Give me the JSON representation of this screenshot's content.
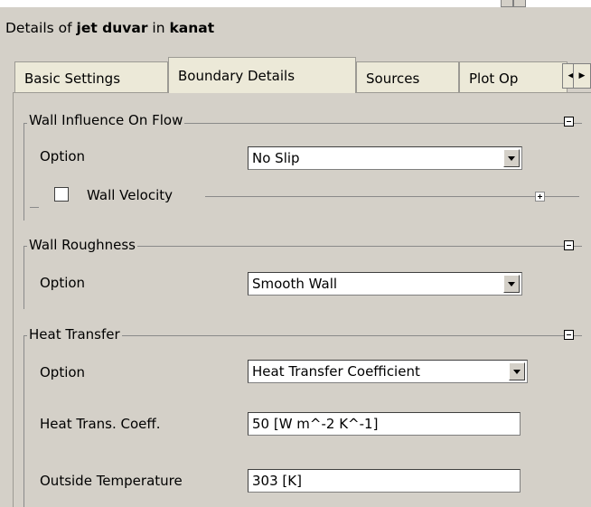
{
  "header": {
    "prefix": "Details of ",
    "object_name": "jet duvar",
    "middle": " in ",
    "domain_name": "kanat"
  },
  "tabs": [
    {
      "label": "Basic Settings"
    },
    {
      "label": "Boundary Details"
    },
    {
      "label": "Sources"
    },
    {
      "label": "Plot Op"
    }
  ],
  "active_tab": "Boundary Details",
  "groups": {
    "wall_influence": {
      "title": "Wall Influence On Flow",
      "option_label": "Option",
      "option_value": "No Slip",
      "wall_velocity_label": "Wall Velocity",
      "wall_velocity_checked": false
    },
    "wall_roughness": {
      "title": "Wall Roughness",
      "option_label": "Option",
      "option_value": "Smooth Wall"
    },
    "heat_transfer": {
      "title": "Heat Transfer",
      "option_label": "Option",
      "option_value": "Heat Transfer Coefficient",
      "coeff_label": "Heat Trans. Coeff.",
      "coeff_value": "50 [W m^-2 K^-1]",
      "temp_label": "Outside Temperature",
      "temp_value": "303 [K]"
    }
  },
  "icons": {
    "scroll_left": "triangle-left-icon",
    "scroll_right": "triangle-right-icon",
    "collapse": "minus-box-icon",
    "expand": "plus-box-icon"
  }
}
